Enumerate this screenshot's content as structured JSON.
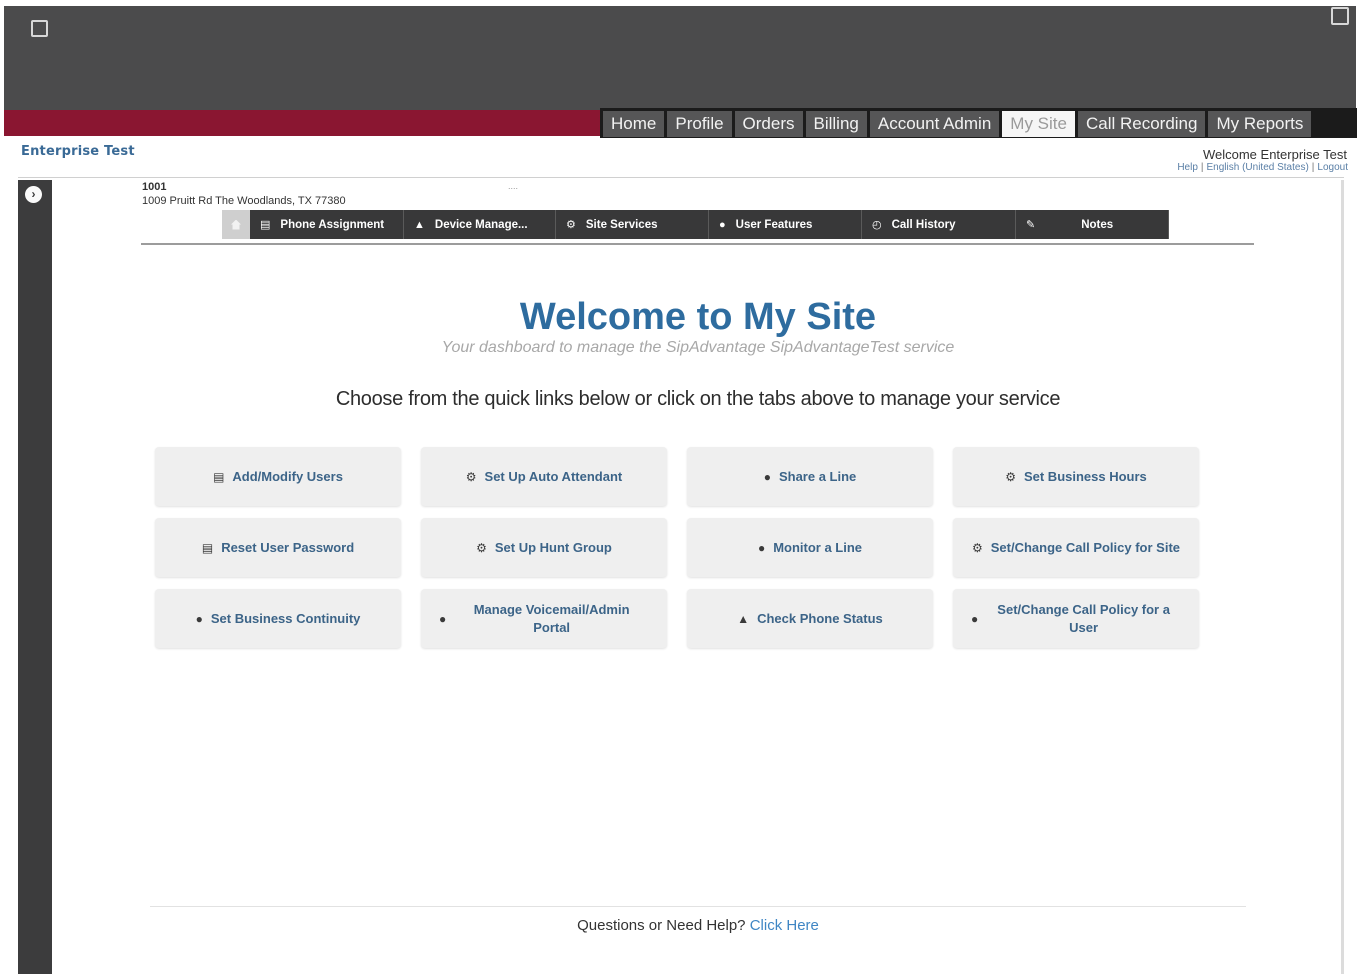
{
  "nav": {
    "tabs": [
      "Home",
      "Profile",
      "Orders",
      "Billing",
      "Account Admin",
      "My Site",
      "Call Recording",
      "My Reports"
    ],
    "active": "My Site"
  },
  "header": {
    "enterprise": "Enterprise Test",
    "welcome_user": "Welcome Enterprise Test",
    "links": [
      "Help",
      "English (United States)",
      "Logout"
    ]
  },
  "site": {
    "number": "1001",
    "address": "1009 Pruitt Rd The Woodlands, TX 77380",
    "dots": "...."
  },
  "subtabs": [
    {
      "icon": "▤",
      "label": "Phone Assignment"
    },
    {
      "icon": "▲",
      "label": "Device Manage..."
    },
    {
      "icon": "⚙",
      "label": "Site Services"
    },
    {
      "icon": "●",
      "label": "User Features"
    },
    {
      "icon": "◴",
      "label": "Call History"
    },
    {
      "icon": "✎",
      "label": "Notes"
    }
  ],
  "main": {
    "title": "Welcome to My Site",
    "subtitle": "Your dashboard to manage the SipAdvantage SipAdvantageTest service",
    "instruction": "Choose from the quick links below or click on the tabs above to manage your service"
  },
  "quick_links": [
    {
      "icon": "▤",
      "label": "Add/Modify Users"
    },
    {
      "icon": "⚙",
      "label": "Set Up Auto Attendant"
    },
    {
      "icon": "●",
      "label": "Share a Line"
    },
    {
      "icon": "⚙",
      "label": "Set Business Hours"
    },
    {
      "icon": "▤",
      "label": "Reset User Password"
    },
    {
      "icon": "⚙",
      "label": "Set Up Hunt Group"
    },
    {
      "icon": "●",
      "label": "Monitor a Line"
    },
    {
      "icon": "⚙",
      "label": "Set/Change Call Policy for Site"
    },
    {
      "icon": "●",
      "label": "Set Business Continuity"
    },
    {
      "icon": "●",
      "label": "Manage Voicemail/Admin Portal"
    },
    {
      "icon": "▲",
      "label": "Check Phone Status"
    },
    {
      "icon": "●",
      "label": "Set/Change Call Policy for a User"
    }
  ],
  "footer": {
    "question": "Questions or Need Help?",
    "link": "Click Here"
  },
  "colors": {
    "maroon_bar": "#8a1631",
    "top_band": "#4b4b4c",
    "title_blue": "#2e6c9f",
    "link_blue": "#3f86c4"
  }
}
